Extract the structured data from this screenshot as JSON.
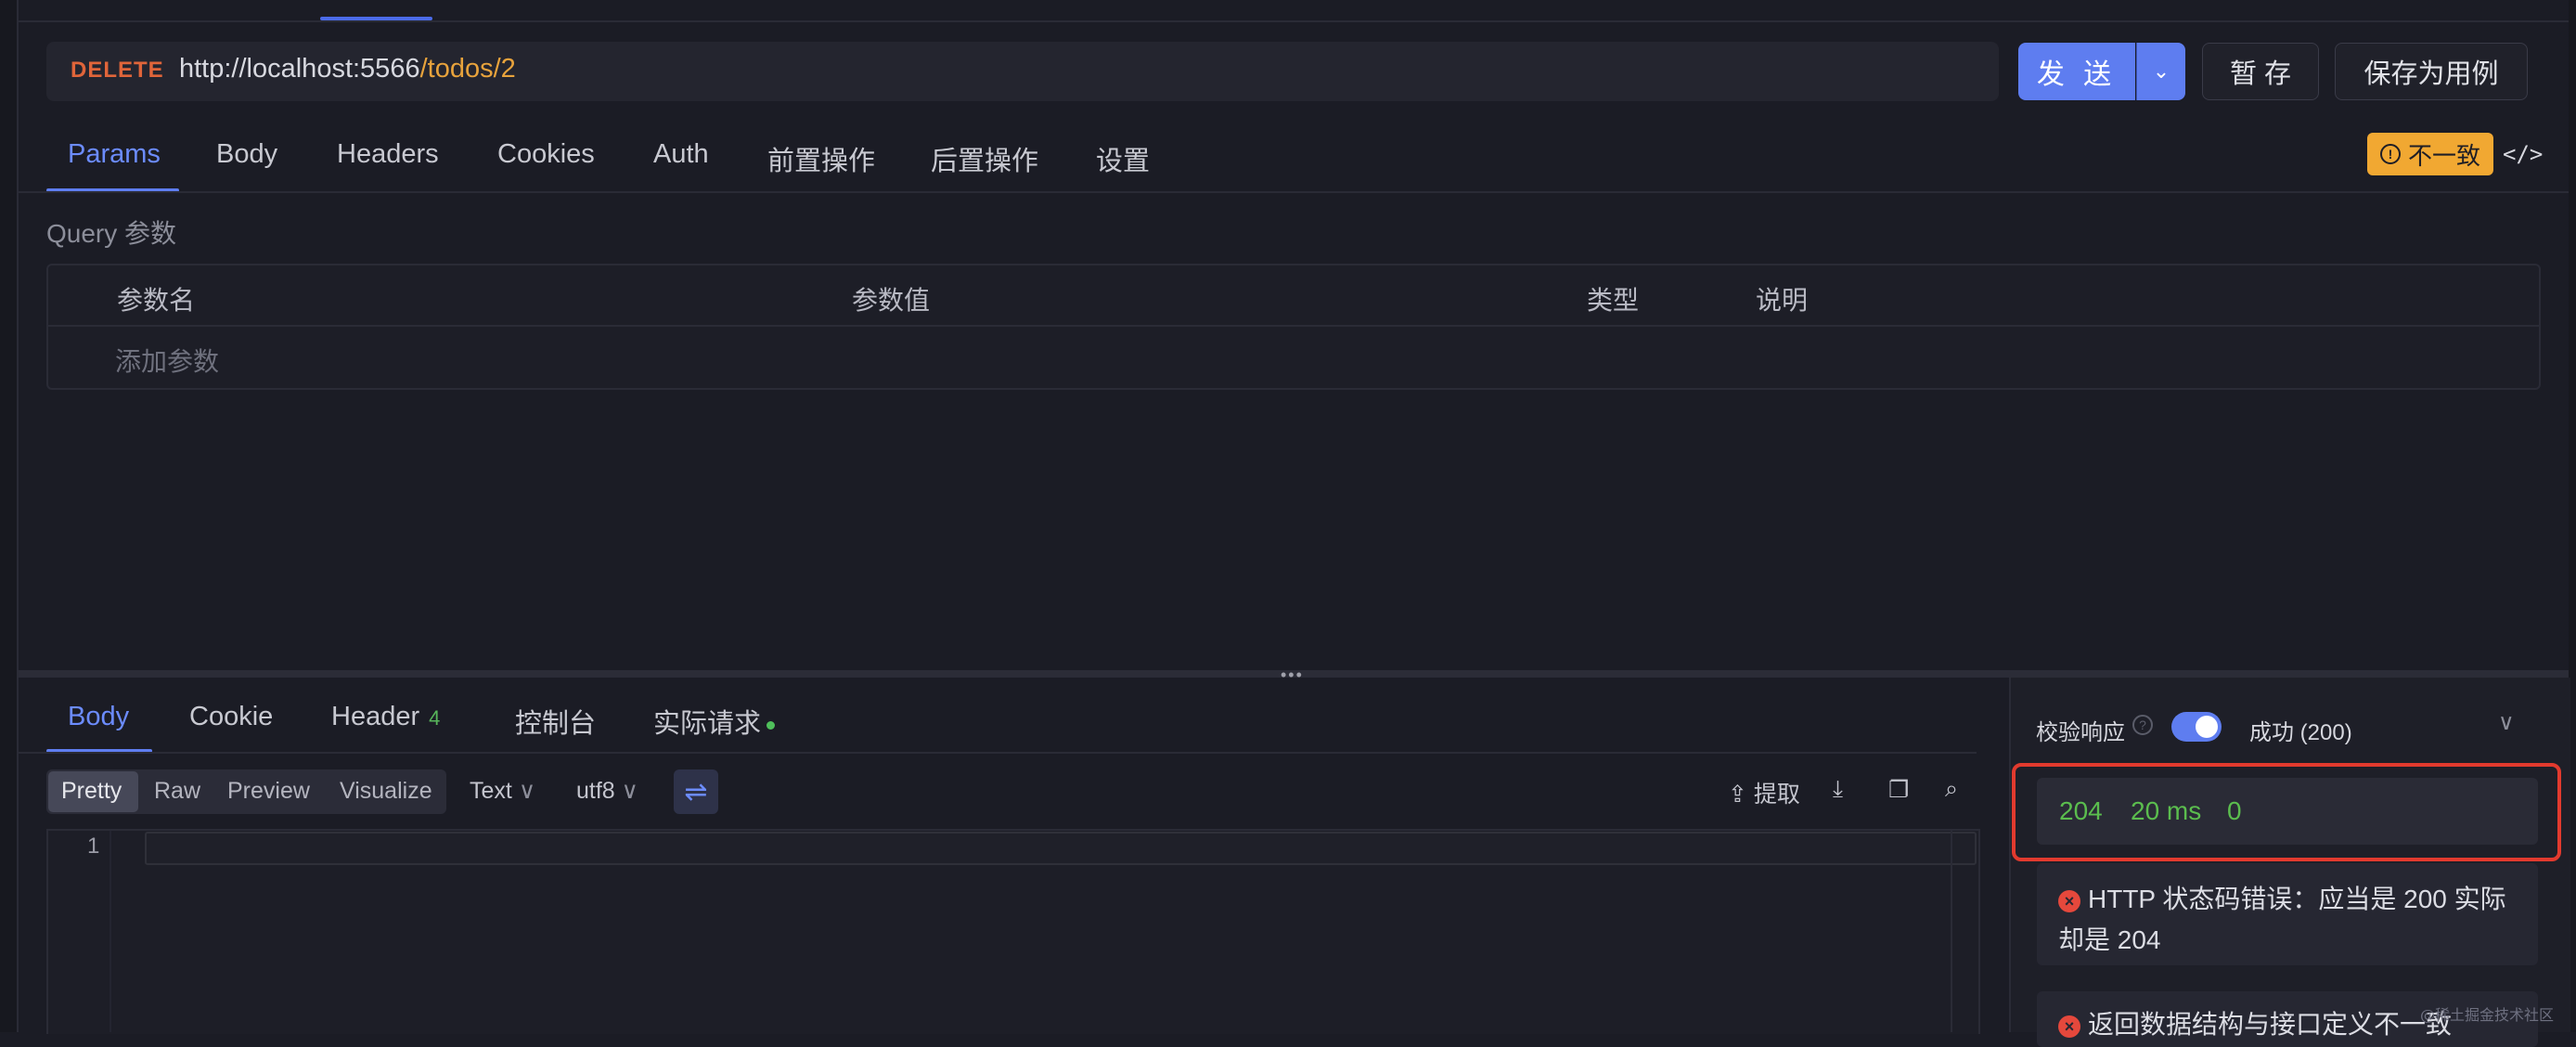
{
  "request": {
    "method": "DELETE",
    "url_base": "http://localhost:5566",
    "url_path": "/todos/2",
    "send_label": "发 送",
    "send_more_icon": "chevron-down-icon",
    "save_temp_label": "暂 存",
    "save_case_label": "保存为用例"
  },
  "request_tabs": [
    {
      "label": "Params",
      "active": true
    },
    {
      "label": "Body"
    },
    {
      "label": "Headers"
    },
    {
      "label": "Cookies"
    },
    {
      "label": "Auth"
    },
    {
      "label": "前置操作"
    },
    {
      "label": "后置操作"
    },
    {
      "label": "设置"
    }
  ],
  "inconsistent_badge": {
    "label": "不一致",
    "icon": "!"
  },
  "code_icon": "</>",
  "params": {
    "section_label": "Query 参数",
    "columns": [
      "参数名",
      "参数值",
      "类型",
      "说明"
    ],
    "add_placeholder": "添加参数"
  },
  "response_tabs": [
    {
      "label": "Body",
      "active": true
    },
    {
      "label": "Cookie"
    },
    {
      "label": "Header",
      "count": "4"
    },
    {
      "label": "控制台"
    },
    {
      "label": "实际请求",
      "dot": true
    }
  ],
  "view_modes": [
    "Pretty",
    "Raw",
    "Preview",
    "Visualize"
  ],
  "format_dropdown": "Text",
  "encoding_dropdown": "utf8",
  "wrap_icon": "⇌",
  "toolbar": {
    "extract_label": "提取"
  },
  "editor": {
    "line_number": "1"
  },
  "validation": {
    "title": "校验响应",
    "help": "?",
    "status": "成功 (200)",
    "toggle_on": true
  },
  "metrics": {
    "status_code": "204",
    "time": "20 ms",
    "size": "0"
  },
  "errors": [
    "HTTP 状态码错误：应当是 200 实际却是 204",
    "返回数据结构与接口定义不一致"
  ],
  "watermark": "@稀土掘金技术社区",
  "colors": {
    "accent": "#5e7df0",
    "warning": "#f1a832",
    "success": "#5bbd4e",
    "error": "#e5483c",
    "method": "#e0653a"
  }
}
